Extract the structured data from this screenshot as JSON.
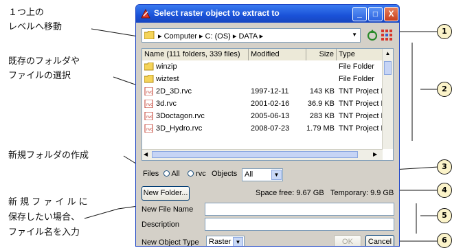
{
  "annotations": {
    "upper_move": [
      "１つ上の",
      "レベルへ移動"
    ],
    "select_existing": [
      "既存のフォルダや",
      "ファイルの選択"
    ],
    "new_folder_create": "新規フォルダの作成",
    "save_new_file": [
      "新 規 フ ァ イ ル に",
      "保存したい場合、",
      "ファイル名を入力"
    ],
    "numbers": [
      "1",
      "2",
      "3",
      "4",
      "5",
      "6"
    ]
  },
  "dialog": {
    "title": "Select raster object to extract to",
    "window_buttons": {
      "minimize": "_",
      "maximize": "□",
      "close": "X"
    },
    "path": {
      "segments": [
        "Computer",
        "C: (OS)",
        "DATA"
      ],
      "separator": "▸"
    },
    "list": {
      "columns": [
        "Name (111 folders, 339 files)",
        "Modified",
        "Size",
        "Type"
      ],
      "rows": [
        {
          "name": "winzip",
          "modified": "",
          "size": "",
          "type": "File Folder",
          "kind": "folder"
        },
        {
          "name": "wiztest",
          "modified": "",
          "size": "",
          "type": "File Folder",
          "kind": "folder"
        },
        {
          "name": "2D_3D.rvc",
          "modified": "1997-12-11",
          "size": "143 KB",
          "type": "TNT Project F",
          "kind": "file"
        },
        {
          "name": "3d.rvc",
          "modified": "2001-02-16",
          "size": "36.9 KB",
          "type": "TNT Project F",
          "kind": "file"
        },
        {
          "name": "3Doctagon.rvc",
          "modified": "2005-06-13",
          "size": "283 KB",
          "type": "TNT Project F",
          "kind": "file"
        },
        {
          "name": "3D_Hydro.rvc",
          "modified": "2008-07-23",
          "size": "1.79 MB",
          "type": "TNT Project F",
          "kind": "file"
        }
      ]
    },
    "filters": {
      "files_label": "Files",
      "all_label": "All",
      "rvc_label": "rvc",
      "objects_label": "Objects",
      "objects_value": "All"
    },
    "new_folder_label": "New Folder...",
    "space_free": "Space free: 9.67 GB",
    "temporary": "Temporary: 9.9 GB",
    "new_file_name_label": "New File Name",
    "description_label": "Description",
    "new_object_type_label": "New Object Type",
    "new_object_type_value": "Raster",
    "ok_label": "OK",
    "cancel_label": "Cancel"
  },
  "colors": {
    "titlebar": "#1a52d8",
    "dialog_bg": "#d4d0c8",
    "callout_fill": "#fbf3c9"
  }
}
